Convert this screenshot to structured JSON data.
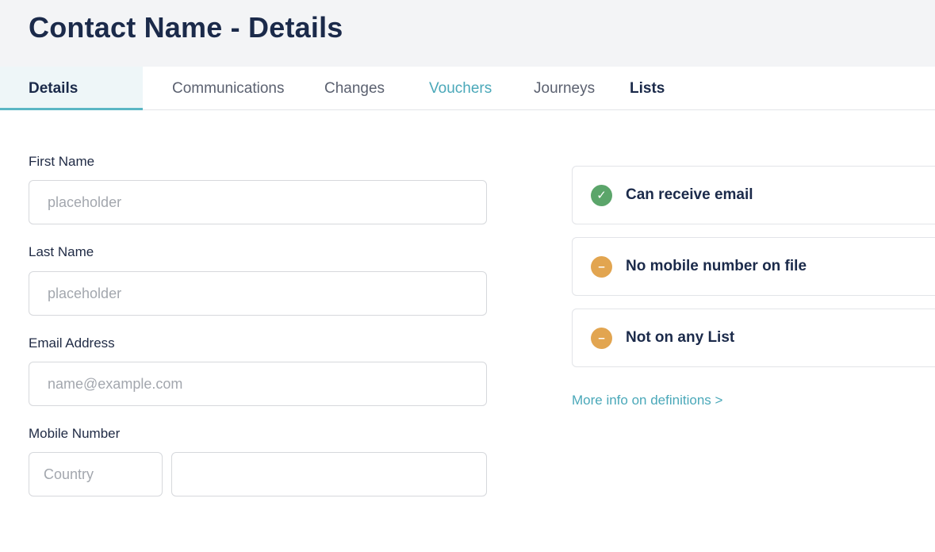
{
  "header": {
    "title": "Contact Name - Details"
  },
  "tabs": [
    {
      "label": "Details"
    },
    {
      "label": "Communications"
    },
    {
      "label": "Changes"
    },
    {
      "label": "Vouchers"
    },
    {
      "label": "Journeys"
    },
    {
      "label": "Lists"
    }
  ],
  "form": {
    "first_name": {
      "label": "First Name",
      "placeholder": "placeholder",
      "value": ""
    },
    "last_name": {
      "label": "Last Name",
      "placeholder": "placeholder",
      "value": ""
    },
    "email": {
      "label": "Email Address",
      "placeholder": "name@example.com",
      "value": ""
    },
    "mobile": {
      "label": "Mobile Number",
      "country_placeholder": "Country",
      "number_placeholder": "",
      "value": ""
    }
  },
  "statuses": [
    {
      "icon": "check-circle-icon",
      "symbol": "✓",
      "text": "Can receive email",
      "color": "#5ba56a"
    },
    {
      "icon": "minus-circle-icon",
      "symbol": "–",
      "text": "No mobile number on file",
      "color": "#e2a550"
    },
    {
      "icon": "minus-circle-icon",
      "symbol": "–",
      "text": "Not on any List",
      "color": "#e2a550"
    }
  ],
  "more_info_link": "More info on definitions >",
  "colors": {
    "accent": "#4aa8b9",
    "title": "#1b2a4a",
    "ok": "#5ba56a",
    "warn": "#e2a550"
  }
}
